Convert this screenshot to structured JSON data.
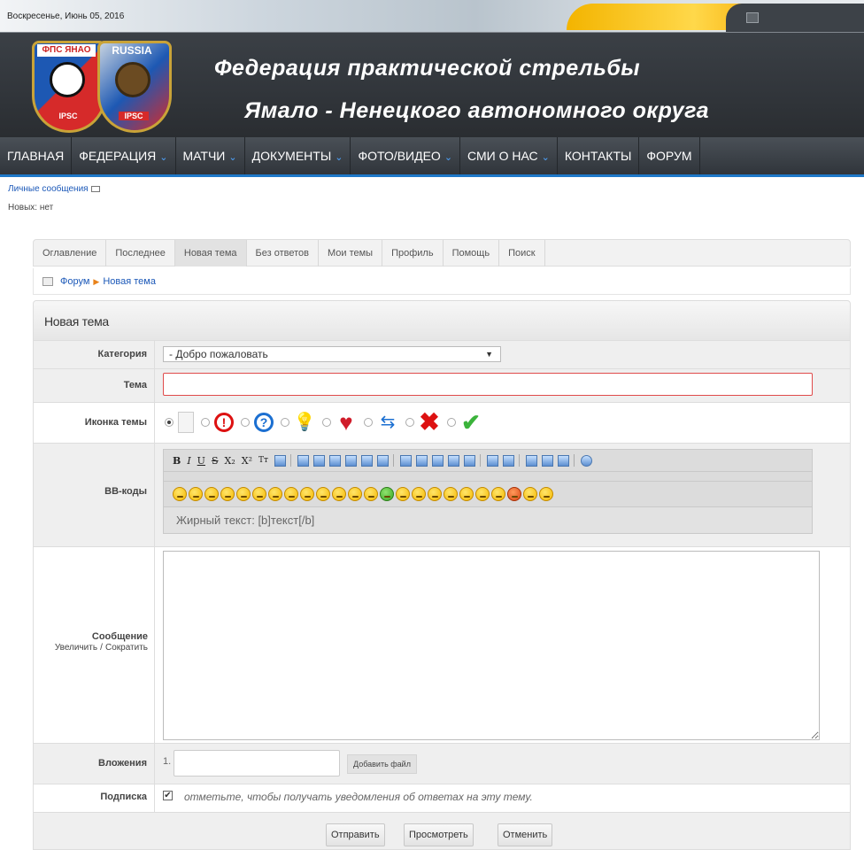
{
  "header": {
    "date": "Воскресенье, Июнь 05, 2016",
    "logo1_text": "ФПС ЯНАО",
    "logo2_text": "RUSSIA",
    "logo_badge": "IPSC",
    "title_line1": "Федерация практической стрельбы",
    "title_line2": "Ямало - Ненецкого автономного округа"
  },
  "nav": {
    "items": [
      {
        "label": "ГЛАВНАЯ",
        "dropdown": false
      },
      {
        "label": "ФЕДЕРАЦИЯ",
        "dropdown": true
      },
      {
        "label": "МАТЧИ",
        "dropdown": true
      },
      {
        "label": "ДОКУМЕНТЫ",
        "dropdown": true
      },
      {
        "label": "ФОТО/ВИДЕО",
        "dropdown": true
      },
      {
        "label": "СМИ О НАС",
        "dropdown": true
      },
      {
        "label": "КОНТАКТЫ",
        "dropdown": false
      },
      {
        "label": "ФОРУМ",
        "dropdown": false
      }
    ],
    "chevron": "⌄"
  },
  "pm": {
    "link": "Личные сообщения",
    "new_label": "Новых: нет"
  },
  "forum": {
    "tabs": [
      "Оглавление",
      "Последнее",
      "Новая тема",
      "Без ответов",
      "Мои темы",
      "Профиль",
      "Помощь",
      "Поиск"
    ],
    "active_tab": 2,
    "breadcrumb": {
      "forum": "Форум",
      "current": "Новая тема",
      "sep": "▶"
    },
    "panel_title": "Новая тема",
    "category": {
      "label": "Категория",
      "value": "- Добро пожаловать",
      "arrow": "▼"
    },
    "topic": {
      "label": "Тема",
      "value": ""
    },
    "topic_icon": {
      "label": "Иконка темы",
      "icons": [
        "page-icon",
        "exclamation-icon",
        "question-icon",
        "lightbulb-icon",
        "heart-icon",
        "arrows-icon",
        "cross-icon",
        "checkmark-icon"
      ],
      "glyphs": [
        "",
        "!",
        "?",
        "💡",
        "♥",
        "⇆",
        "✖",
        "✔"
      ],
      "selected": 0
    },
    "bbcodes": {
      "label": "BB-коды",
      "toolbar_text": [
        "B",
        "I",
        "U",
        "S",
        "X₂",
        "X²",
        "Tт"
      ],
      "hint": "Жирный текст: [b]текст[/b]",
      "smileys_count": 24
    },
    "message": {
      "label": "Сообщение",
      "enlarge": "Увеличить",
      "sep": "/",
      "shrink": "Сократить"
    },
    "attachments": {
      "label": "Вложения",
      "number": "1.",
      "button": "Добавить файл"
    },
    "subscribe": {
      "label": "Подписка",
      "checked": true,
      "text": "отметьте, чтобы получать уведомления об ответах на эту тему."
    },
    "buttons": {
      "send": "Отправить",
      "preview": "Просмотреть",
      "cancel": "Отменить"
    }
  }
}
